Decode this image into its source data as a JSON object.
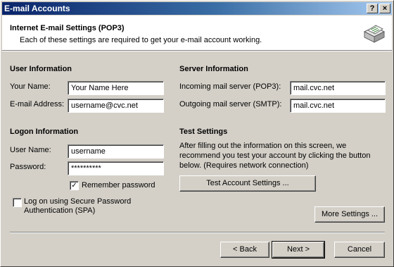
{
  "window": {
    "title": "E-mail Accounts",
    "help_button": "?",
    "close_button": "×"
  },
  "header": {
    "title": "Internet E-mail Settings (POP3)",
    "subtitle": "Each of these settings are required to get your e-mail account working."
  },
  "user_info": {
    "heading": "User Information",
    "your_name_label": "Your Name:",
    "your_name_value": "Your Name Here",
    "email_label": "E-mail Address:",
    "email_value": "username@cvc.net"
  },
  "server_info": {
    "heading": "Server Information",
    "incoming_label": "Incoming mail server (POP3):",
    "incoming_value": "mail.cvc.net",
    "outgoing_label": "Outgoing mail server (SMTP):",
    "outgoing_value": "mail.cvc.net"
  },
  "logon_info": {
    "heading": "Logon Information",
    "username_label": "User Name:",
    "username_value": "username",
    "password_label": "Password:",
    "password_value": "**********",
    "remember_label": "Remember password",
    "remember_checked": true,
    "spa_label_line1": "Log on using Secure Password",
    "spa_label_line2": "Authentication (SPA)",
    "spa_checked": false
  },
  "test_settings": {
    "heading": "Test Settings",
    "description": "After filling out the information on this screen, we recommend you test your account by clicking the button below. (Requires network connection)",
    "test_button": "Test Account Settings ..."
  },
  "buttons": {
    "more_settings": "More Settings ...",
    "back": "< Back",
    "next": "Next >",
    "cancel": "Cancel"
  },
  "check_mark": "✓"
}
